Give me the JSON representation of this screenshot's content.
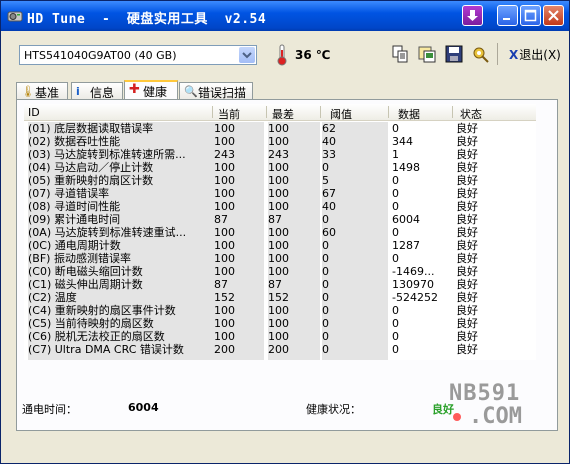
{
  "window": {
    "title": "HD Tune  -  硬盘实用工具  v2.54"
  },
  "toolbar": {
    "drive": "HTS541040G9AT00 (40 GB)",
    "temperature": "36 ℃",
    "exit_label": "退出(X)",
    "exit_prefix": "X",
    "icons": [
      "copy-icon",
      "copy-screenshot-icon",
      "save-icon",
      "options-icon"
    ]
  },
  "tabs": [
    {
      "label": "基准",
      "icon": "thermometer-icon"
    },
    {
      "label": "信息",
      "icon": "info-icon"
    },
    {
      "label": "健康",
      "icon": "plus-icon",
      "active": true
    },
    {
      "label": "错误扫描",
      "icon": "magnifier-icon"
    }
  ],
  "table": {
    "columns": [
      "ID",
      "当前",
      "最差",
      "阈值",
      "数据",
      "状态"
    ],
    "rows": [
      [
        "(01) 底层数据读取错误率",
        "100",
        "100",
        "62",
        "0",
        "良好"
      ],
      [
        "(02) 数据吞吐性能",
        "100",
        "100",
        "40",
        "344",
        "良好"
      ],
      [
        "(03) 马达旋转到标准转速所需...",
        "243",
        "243",
        "33",
        "1",
        "良好"
      ],
      [
        "(04) 马达启动／停止计数",
        "100",
        "100",
        "0",
        "1498",
        "良好"
      ],
      [
        "(05) 重新映射的扇区计数",
        "100",
        "100",
        "5",
        "0",
        "良好"
      ],
      [
        "(07) 寻道错误率",
        "100",
        "100",
        "67",
        "0",
        "良好"
      ],
      [
        "(08) 寻道时间性能",
        "100",
        "100",
        "40",
        "0",
        "良好"
      ],
      [
        "(09) 累计通电时间",
        "87",
        "87",
        "0",
        "6004",
        "良好"
      ],
      [
        "(0A) 马达旋转到标准转速重试...",
        "100",
        "100",
        "60",
        "0",
        "良好"
      ],
      [
        "(0C) 通电周期计数",
        "100",
        "100",
        "0",
        "1287",
        "良好"
      ],
      [
        "(BF) 振动感测错误率",
        "100",
        "100",
        "0",
        "0",
        "良好"
      ],
      [
        "(C0) 断电磁头缩回计数",
        "100",
        "100",
        "0",
        "-1469...",
        "良好"
      ],
      [
        "(C1) 磁头伸出周期计数",
        "87",
        "87",
        "0",
        "130970",
        "良好"
      ],
      [
        "(C2) 温度",
        "152",
        "152",
        "0",
        "-524252",
        "良好"
      ],
      [
        "(C4) 重新映射的扇区事件计数",
        "100",
        "100",
        "0",
        "0",
        "良好"
      ],
      [
        "(C5) 当前待映射的扇区数",
        "100",
        "100",
        "0",
        "0",
        "良好"
      ],
      [
        "(C6) 脱机无法校正的扇区数",
        "100",
        "100",
        "0",
        "0",
        "良好"
      ],
      [
        "(C7) Ultra DMA CRC 错误计数",
        "200",
        "200",
        "0",
        "0",
        "良好"
      ]
    ]
  },
  "status": {
    "power_on_label": "通电时间：",
    "power_on_value": "6004",
    "health_label": "健康状况：",
    "health_value": "良好"
  },
  "watermark": {
    "line1": "NB591",
    "line2": ".COM"
  },
  "colors": {
    "health_good": "#2aa02a",
    "title_blue": "#0054e3"
  }
}
